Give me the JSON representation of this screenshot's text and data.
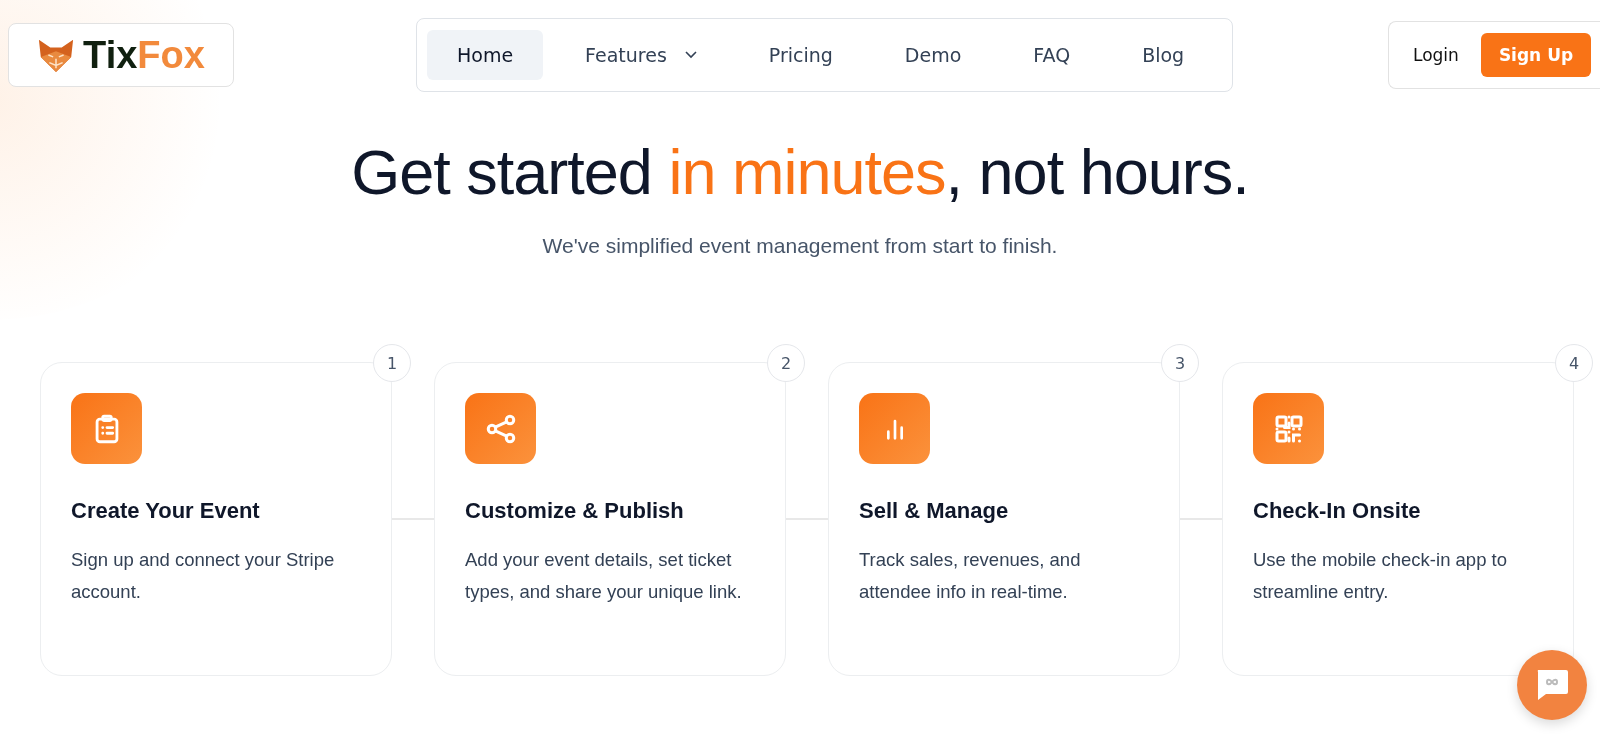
{
  "logo": {
    "parts": [
      {
        "text": "Tix",
        "accent": false
      },
      {
        "text": "Fox",
        "accent": true
      }
    ]
  },
  "nav": [
    {
      "label": "Home",
      "selected": true,
      "dropdown": false
    },
    {
      "label": "Features",
      "selected": false,
      "dropdown": true
    },
    {
      "label": "Pricing",
      "selected": false,
      "dropdown": false
    },
    {
      "label": "Demo",
      "selected": false,
      "dropdown": false
    },
    {
      "label": "FAQ",
      "selected": false,
      "dropdown": false
    },
    {
      "label": "Blog",
      "selected": false,
      "dropdown": false
    }
  ],
  "auth": {
    "login": "Login",
    "signup": "Sign Up"
  },
  "hero": {
    "title_parts": [
      {
        "text": "Get started ",
        "accent": false
      },
      {
        "text": "in minutes",
        "accent": true
      },
      {
        "text": ", not hours.",
        "accent": false
      }
    ],
    "subtitle": "We've simplified event management from start to finish."
  },
  "steps": [
    {
      "number": "1",
      "kind": "clipboard",
      "title": "Create Your Event",
      "text": "Sign up and connect your Stripe account."
    },
    {
      "number": "2",
      "kind": "share",
      "title": "Customize & Publish",
      "text": "Add your event details, set ticket types, and share your unique link."
    },
    {
      "number": "3",
      "kind": "chart",
      "title": "Sell & Manage",
      "text": "Track sales, revenues, and attendee info in real-time."
    },
    {
      "number": "4",
      "kind": "qr",
      "title": "Check-In Onsite",
      "text": "Use the mobile check-in app to streamline entry."
    }
  ]
}
